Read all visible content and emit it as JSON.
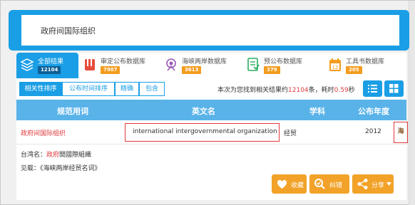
{
  "search": {
    "query": "政府间国际组织"
  },
  "db_tabs": [
    {
      "label": "全部结果",
      "count": "12104",
      "icon": "layers-icon"
    },
    {
      "label": "审定公布数据库",
      "count": "7907",
      "icon": "book-icon"
    },
    {
      "label": "海峡两岸数据库",
      "count": "3613",
      "icon": "bridge-icon"
    },
    {
      "label": "预公布数据库",
      "count": "379",
      "icon": "document-icon"
    },
    {
      "label": "工具书数据库",
      "count": "205",
      "icon": "calendar-icon"
    }
  ],
  "sort_buttons": [
    "相关性排序",
    "公布时间排序",
    "精确",
    "包含"
  ],
  "result_info": {
    "prefix": "本次为您找到相关结果约",
    "count": "12104",
    "middle": "条，耗时",
    "time": "0.59",
    "suffix": "秒"
  },
  "table": {
    "headers": [
      "规范用词",
      "英文名",
      "学科",
      "公布年度"
    ],
    "row": {
      "term": "政府间国际组织",
      "english": "international intergovernmental organization",
      "subject": "经贸",
      "year": "2012",
      "flag": "海"
    }
  },
  "detail": {
    "taiwan_label": "台湾名：",
    "taiwan_highlight": "政府",
    "taiwan_rest": "間國際組織",
    "seealso_label": "见载：",
    "seealso_value": "《海峡两岸经贸名词》"
  },
  "actions": [
    {
      "label": "收藏",
      "icon": "heart-icon"
    },
    {
      "label": "纠错",
      "icon": "search-correct-icon"
    },
    {
      "label": "分享",
      "icon": "share-icon"
    }
  ],
  "colors": {
    "accent": "#1a9ee6",
    "header": "#59b3e9",
    "orange": "#f2a228",
    "red": "#e0383b"
  }
}
